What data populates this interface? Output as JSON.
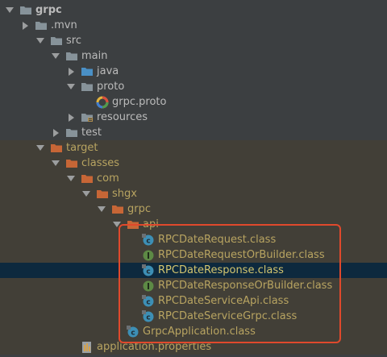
{
  "tree": [
    {
      "label": "grpc",
      "icon": "folder-icon",
      "state": "open",
      "style": "bold",
      "row": "normal"
    },
    {
      "label": ".mvn",
      "icon": "folder-icon",
      "state": "closed",
      "style": "normal",
      "row": "normal"
    },
    {
      "label": "src",
      "icon": "folder-icon",
      "state": "open",
      "style": "normal",
      "row": "normal"
    },
    {
      "label": "main",
      "icon": "folder-icon",
      "state": "open",
      "style": "normal",
      "row": "normal"
    },
    {
      "label": "java",
      "icon": "source-folder-icon",
      "state": "closed",
      "style": "normal",
      "row": "normal"
    },
    {
      "label": "proto",
      "icon": "folder-icon",
      "state": "open",
      "style": "normal",
      "row": "normal"
    },
    {
      "label": "grpc.proto",
      "icon": "proto-file-icon",
      "state": "leaf",
      "style": "normal",
      "row": "normal"
    },
    {
      "label": "resources",
      "icon": "resources-folder-icon",
      "state": "closed",
      "style": "normal",
      "row": "normal"
    },
    {
      "label": "test",
      "icon": "folder-icon",
      "state": "closed",
      "style": "normal",
      "row": "normal"
    },
    {
      "label": "target",
      "icon": "excluded-folder-icon",
      "state": "open",
      "style": "exc",
      "row": "excluded"
    },
    {
      "label": "classes",
      "icon": "excluded-folder-icon",
      "state": "open",
      "style": "exc",
      "row": "excluded"
    },
    {
      "label": "com",
      "icon": "excluded-folder-icon",
      "state": "open",
      "style": "exc",
      "row": "excluded"
    },
    {
      "label": "shgx",
      "icon": "excluded-folder-icon",
      "state": "open",
      "style": "exc",
      "row": "excluded"
    },
    {
      "label": "grpc",
      "icon": "excluded-folder-icon",
      "state": "open",
      "style": "exc",
      "row": "excluded"
    },
    {
      "label": "api",
      "icon": "excluded-folder-icon",
      "state": "open",
      "style": "exc",
      "row": "excluded"
    },
    {
      "label": "RPCDateRequest.class",
      "icon": "class-file-icon",
      "state": "leaf",
      "style": "exc",
      "row": "excluded"
    },
    {
      "label": "RPCDateRequestOrBuilder.class",
      "icon": "interface-file-icon",
      "state": "leaf",
      "style": "exc",
      "row": "excluded"
    },
    {
      "label": "RPCDateResponse.class",
      "icon": "class-file-icon",
      "state": "leaf",
      "style": "sel",
      "row": "selected"
    },
    {
      "label": "RPCDateResponseOrBuilder.class",
      "icon": "interface-file-icon",
      "state": "leaf",
      "style": "exc",
      "row": "excluded"
    },
    {
      "label": "RPCDateServiceApi.class",
      "icon": "class-file-icon",
      "state": "leaf",
      "style": "exc",
      "row": "excluded"
    },
    {
      "label": "RPCDateServiceGrpc.class",
      "icon": "class-file-icon",
      "state": "leaf",
      "style": "exc",
      "row": "excluded"
    },
    {
      "label": "GrpcApplication.class",
      "icon": "class-file-icon",
      "state": "leaf",
      "style": "exc",
      "row": "excluded"
    },
    {
      "label": "application.properties",
      "icon": "properties-file-icon",
      "state": "leaf",
      "style": "exc",
      "row": "excluded"
    }
  ],
  "colors": {
    "background": "#3c3f41",
    "excluded_row": "#423f37",
    "selected_row": "#0d293e",
    "highlight_box": "#e0492c",
    "folder": "#87939a",
    "source_folder": "#4a90c6",
    "excluded_folder": "#c76636",
    "class_icon": "#3d8fb5",
    "interface_icon": "#5d8a45"
  }
}
